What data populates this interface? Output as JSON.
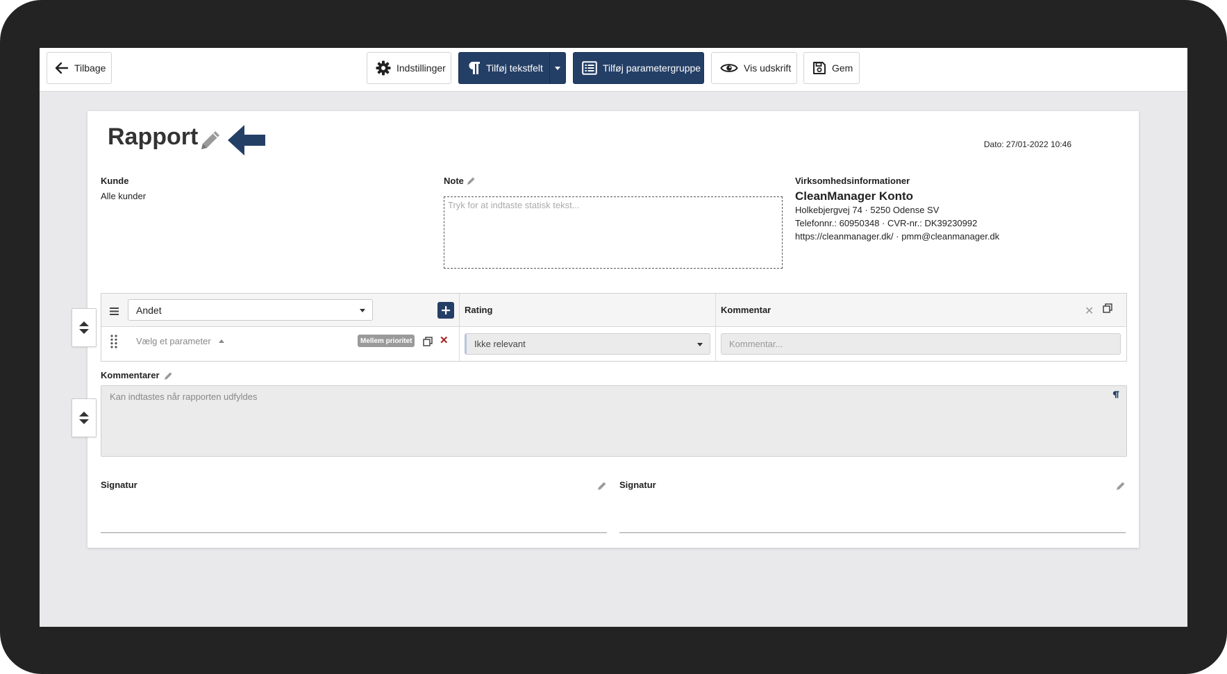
{
  "toolbar": {
    "back_label": "Tilbage",
    "settings_label": "Indstillinger",
    "add_textfield_label": "Tilføj tekstfelt",
    "add_paramgroup_label": "Tilføj parametergruppe",
    "preview_label": "Vis udskrift",
    "save_label": "Gem"
  },
  "report": {
    "title": "Rapport",
    "date": "Dato: 27/01-2022 10:46"
  },
  "customer": {
    "label": "Kunde",
    "value": "Alle kunder"
  },
  "note": {
    "label": "Note",
    "placeholder": "Tryk for at indtaste statisk tekst..."
  },
  "company": {
    "label": "Virksomhedsinformationer",
    "name": "CleanManager Konto",
    "address": "Holkebjergvej 74 · 5250 Odense SV",
    "phone_cvr": "Telefonnr.: 60950348 · CVR-nr.: DK39230992",
    "web_email": "https://cleanmanager.dk/ · pmm@cleanmanager.dk"
  },
  "parameter_group": {
    "group_select": "Andet",
    "col_rating": "Rating",
    "col_comment": "Kommentar",
    "row": {
      "parameter_placeholder": "Vælg et parameter",
      "priority_badge": "Mellem prioritet",
      "rating_value": "Ikke relevant",
      "comment_placeholder": "Kommentar..."
    }
  },
  "comments": {
    "label": "Kommentarer",
    "placeholder": "Kan indtastes når rapporten udfyldes"
  },
  "signatures": [
    {
      "label": "Signatur"
    },
    {
      "label": "Signatur"
    }
  ],
  "colors": {
    "primary": "#243f66",
    "badge": "#9a9a9a",
    "delete": "#a52020"
  }
}
